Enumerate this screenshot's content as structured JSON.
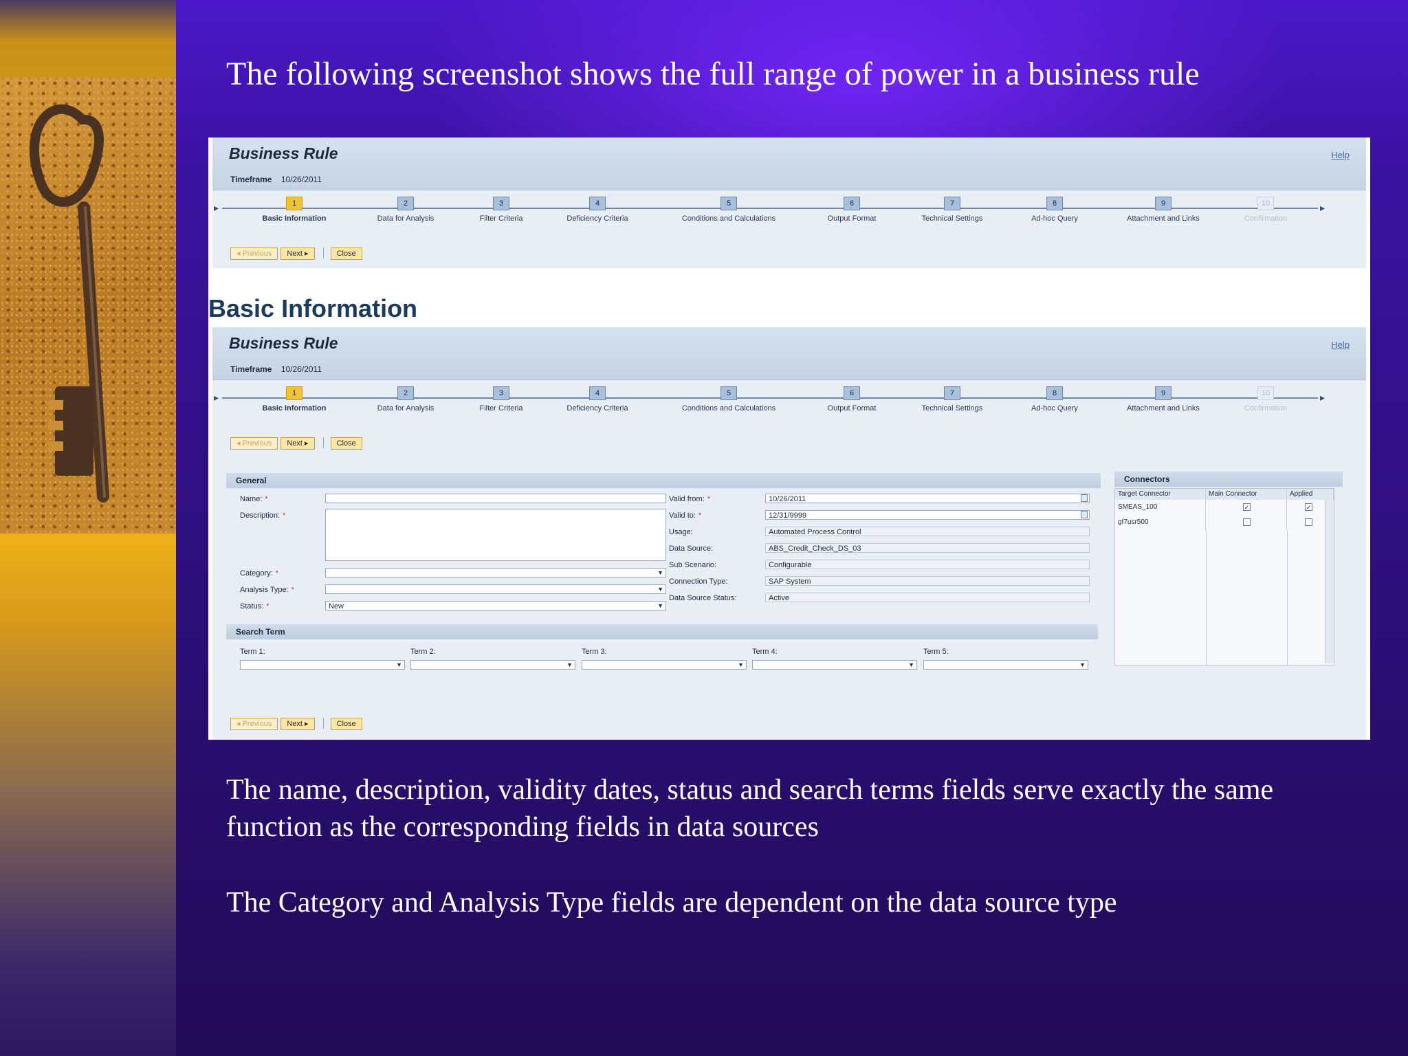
{
  "slide": {
    "title": "The following screenshot shows the full range of power in a business rule",
    "paragraph1": "The name, description, validity dates, status and search terms fields serve exactly the same function as the corresponding fields in data sources",
    "paragraph2": "The Category and Analysis Type fields are dependent on the data source type"
  },
  "screenshot": {
    "rule_title": "Business Rule",
    "help": "Help",
    "timeframe_label": "Timeframe",
    "timeframe_value": "10/26/2011",
    "steps": [
      {
        "num": "1",
        "label": "Basic Information"
      },
      {
        "num": "2",
        "label": "Data for Analysis"
      },
      {
        "num": "3",
        "label": "Filter Criteria"
      },
      {
        "num": "4",
        "label": "Deficiency Criteria"
      },
      {
        "num": "5",
        "label": "Conditions and Calculations"
      },
      {
        "num": "6",
        "label": "Output Format"
      },
      {
        "num": "7",
        "label": "Technical Settings"
      },
      {
        "num": "8",
        "label": "Ad-hoc Query"
      },
      {
        "num": "9",
        "label": "Attachment and Links"
      },
      {
        "num": "10",
        "label": "Confirmation"
      }
    ],
    "nav": {
      "previous": "◂ Previous",
      "next": "Next ▸",
      "close": "Close"
    },
    "section_heading": "Basic Information",
    "general": {
      "title": "General",
      "name_label": "Name:",
      "description_label": "Description:",
      "category_label": "Category:",
      "analysis_type_label": "Analysis Type:",
      "status_label": "Status:",
      "status_value": "New",
      "valid_from_label": "Valid from:",
      "valid_from_value": "10/26/2011",
      "valid_to_label": "Valid to:",
      "valid_to_value": "12/31/9999",
      "usage_label": "Usage:",
      "usage_value": "Automated Process Control",
      "data_source_label": "Data Source:",
      "data_source_value": "ABS_Credit_Check_DS_03",
      "sub_scenario_label": "Sub Scenario:",
      "sub_scenario_value": "Configurable",
      "connection_type_label": "Connection Type:",
      "connection_type_value": "SAP System",
      "ds_status_label": "Data Source Status:",
      "ds_status_value": "Active",
      "required_mark": "*"
    },
    "search": {
      "title": "Search Term",
      "terms": [
        "Term 1:",
        "Term 2:",
        "Term 3:",
        "Term 4:",
        "Term 5:"
      ]
    },
    "connectors": {
      "title": "Connectors",
      "columns": [
        "Target Connector",
        "Main Connector",
        "Applied"
      ],
      "rows": [
        {
          "name": "SMEAS_100",
          "main": "✓",
          "applied": "✓"
        },
        {
          "name": "gf7usr500",
          "main": "",
          "applied": ""
        }
      ]
    }
  }
}
